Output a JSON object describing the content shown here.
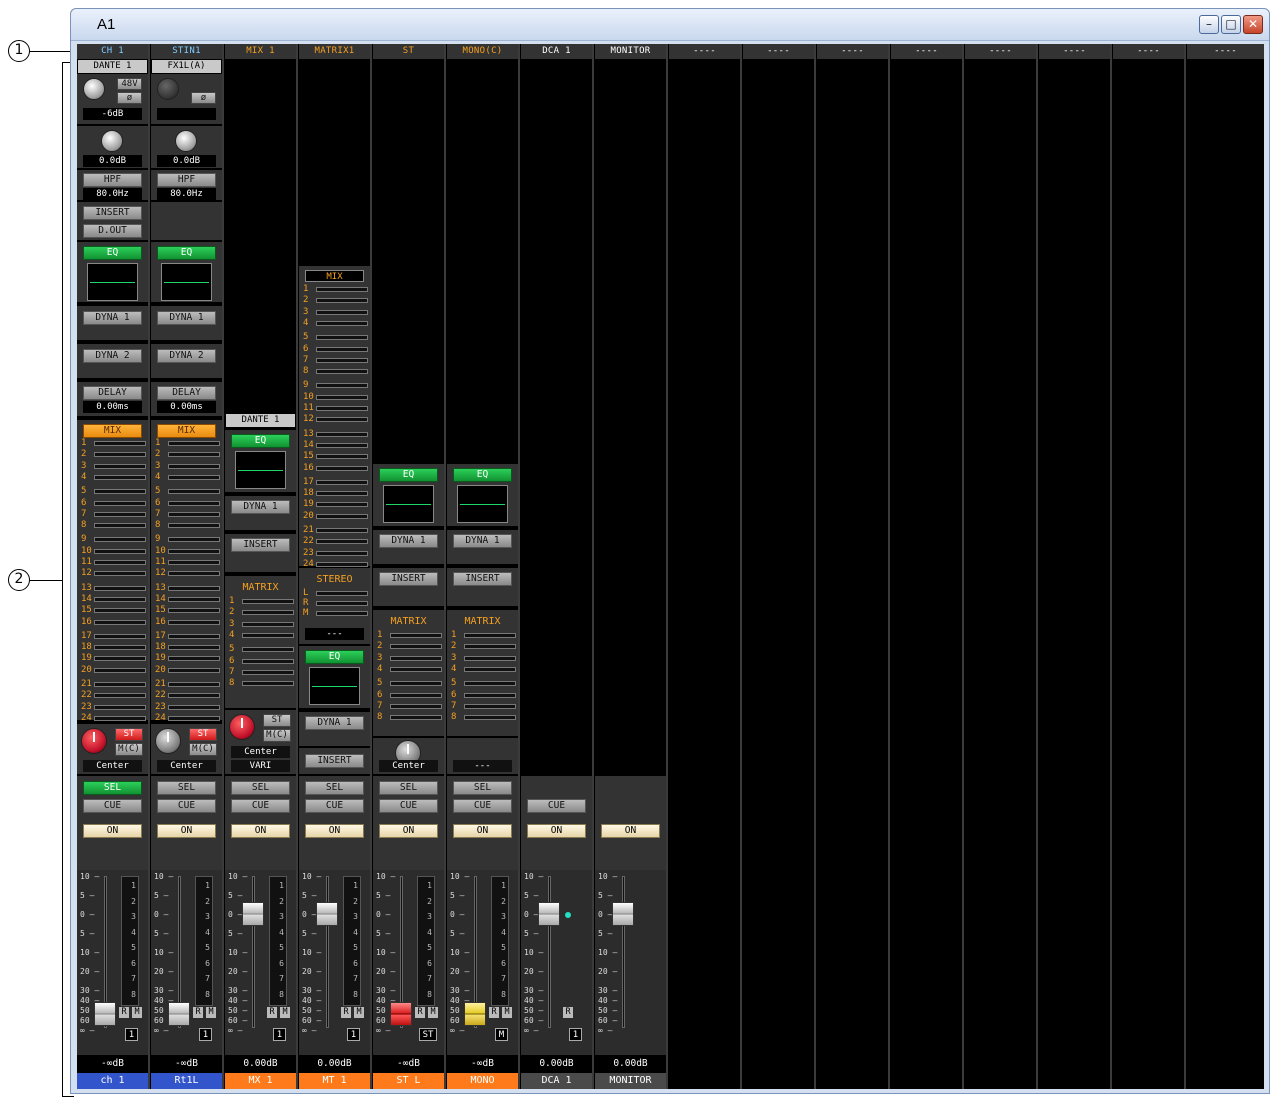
{
  "window": {
    "title": "A1",
    "btn_min": "–",
    "btn_max": "□",
    "btn_close": "✕"
  },
  "callouts": {
    "c1": "1",
    "c2": "2"
  },
  "strips": [
    {
      "top": "CH 1",
      "patch": "DANTE 1",
      "phantom": "48V",
      "phase": "ø",
      "gain": "-6dB",
      "digital_gain": "0.0dB",
      "hpf": "HPF",
      "hpf_freq": "80.0Hz",
      "insert": "INSERT",
      "dout": "D.OUT",
      "eq": "EQ",
      "dyna1": "DYNA 1",
      "dyna2": "DYNA 2",
      "delay": "DELAY",
      "delay_val": "0.00ms",
      "mix": "MIX",
      "st": "ST",
      "mc": "M(C)",
      "pan": "Center",
      "sel": "SEL",
      "cue": "CUE",
      "on": "ON",
      "rm_r": "R",
      "rm_m": "M",
      "badge": "1",
      "level": "-∞dB",
      "name": "ch 1"
    },
    {
      "top": "STIN1",
      "patch": "FX1L(A)",
      "phase": "ø",
      "digital_gain": "0.0dB",
      "hpf": "HPF",
      "hpf_freq": "80.0Hz",
      "eq": "EQ",
      "dyna1": "DYNA 1",
      "dyna2": "DYNA 2",
      "delay": "DELAY",
      "delay_val": "0.00ms",
      "mix": "MIX",
      "st": "ST",
      "mc": "M(C)",
      "pan": "Center",
      "sel": "SEL",
      "cue": "CUE",
      "on": "ON",
      "rm_r": "R",
      "rm_m": "M",
      "badge": "1",
      "level": "-∞dB",
      "name": "Rt1L"
    },
    {
      "top": "MIX 1",
      "patch": "DANTE 1",
      "eq": "EQ",
      "dyna1": "DYNA 1",
      "insert": "INSERT",
      "matrix": "MATRIX",
      "st": "ST",
      "mc": "M(C)",
      "pan": "Center",
      "pan2": "VARI",
      "sel": "SEL",
      "cue": "CUE",
      "on": "ON",
      "rm_r": "R",
      "rm_m": "M",
      "badge": "1",
      "level": "0.00dB",
      "name": "MX 1"
    },
    {
      "top": "MATRIX1",
      "mix": "MIX",
      "stereo": "STEREO",
      "st_l": "L",
      "st_r": "R",
      "st_m": "M",
      "dash": "---",
      "eq": "EQ",
      "dyna1": "DYNA 1",
      "insert": "INSERT",
      "sel": "SEL",
      "cue": "CUE",
      "on": "ON",
      "rm_r": "R",
      "rm_m": "M",
      "badge": "1",
      "level": "0.00dB",
      "name": "MT 1"
    },
    {
      "top": "ST",
      "eq": "EQ",
      "dyna1": "DYNA 1",
      "insert": "INSERT",
      "matrix": "MATRIX",
      "pan": "Center",
      "sel": "SEL",
      "cue": "CUE",
      "on": "ON",
      "rm_r": "R",
      "rm_m": "M",
      "badge": "ST",
      "level": "-∞dB",
      "name": "ST L"
    },
    {
      "top": "MONO(C)",
      "eq": "EQ",
      "dyna1": "DYNA 1",
      "insert": "INSERT",
      "matrix": "MATRIX",
      "pan": "---",
      "sel": "SEL",
      "cue": "CUE",
      "on": "ON",
      "rm_r": "R",
      "rm_m": "M",
      "badge": "M",
      "level": "-∞dB",
      "name": "MONO"
    },
    {
      "top": "DCA 1",
      "cue": "CUE",
      "on": "ON",
      "rm_r": "R",
      "badge": "1",
      "level": "0.00dB",
      "name": "DCA 1"
    },
    {
      "top": "MONITOR",
      "on": "ON",
      "level": "0.00dB",
      "name": "MONITOR"
    }
  ],
  "empty_strips": [
    "----",
    "----",
    "----",
    "----",
    "----",
    "----",
    "----",
    "----"
  ],
  "scale_marks": [
    "10",
    "5",
    "0",
    "5",
    "10",
    "20",
    "30",
    "40",
    "50",
    "60",
    "∞"
  ],
  "meter_marks": [
    "1",
    "2",
    "3",
    "4",
    "5",
    "6",
    "7",
    "8"
  ],
  "send_numbers_24": [
    "1",
    "2",
    "3",
    "4",
    "5",
    "6",
    "7",
    "8",
    "9",
    "10",
    "11",
    "12",
    "13",
    "14",
    "15",
    "16",
    "17",
    "18",
    "19",
    "20",
    "21",
    "22",
    "23",
    "24"
  ],
  "send_numbers_8": [
    "1",
    "2",
    "3",
    "4",
    "5",
    "6",
    "7",
    "8"
  ],
  "colors": {
    "name_blue": "#3355cc",
    "name_orange": "#ff7a1a",
    "name_gray": "#4a4a4a",
    "name_bg_dark": "#333333"
  }
}
